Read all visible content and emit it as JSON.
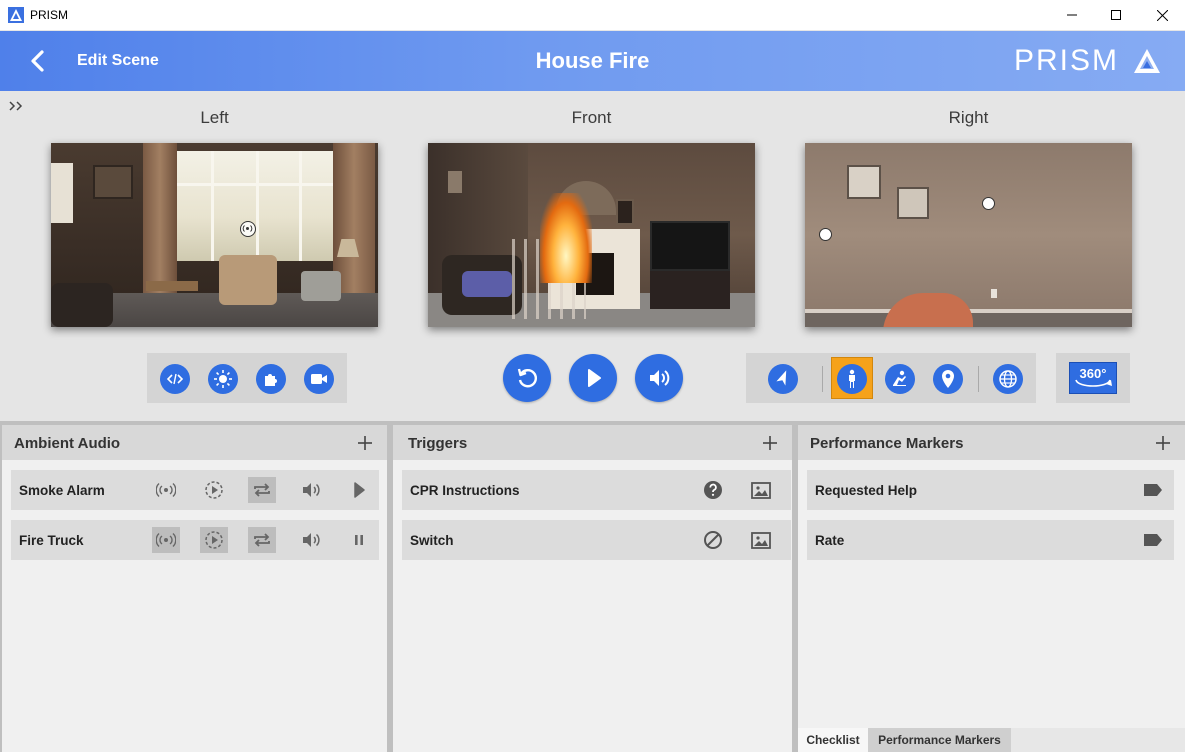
{
  "window": {
    "app_name": "PRISM"
  },
  "header": {
    "back_label": "Edit Scene",
    "scene_title": "House Fire",
    "logo_text": "PRISM"
  },
  "views": {
    "left_label": "Left",
    "front_label": "Front",
    "right_label": "Right"
  },
  "toolbar": {
    "badge_360": "360°"
  },
  "panels": {
    "ambient_audio": {
      "title": "Ambient Audio",
      "items": [
        {
          "label": "Smoke Alarm",
          "state": "stopped"
        },
        {
          "label": "Fire Truck",
          "state": "playing"
        }
      ]
    },
    "triggers": {
      "title": "Triggers",
      "items": [
        {
          "label": "CPR Instructions"
        },
        {
          "label": "Switch"
        }
      ]
    },
    "performance_markers": {
      "title": "Performance Markers",
      "items": [
        {
          "label": "Requested Help"
        },
        {
          "label": "Rate"
        }
      ],
      "tabs": [
        "Checklist",
        "Performance Markers"
      ]
    }
  },
  "colors": {
    "accent": "#2f6de1",
    "active": "#f6a21a",
    "header_start": "#4f80ea",
    "header_end": "#86abf3"
  }
}
